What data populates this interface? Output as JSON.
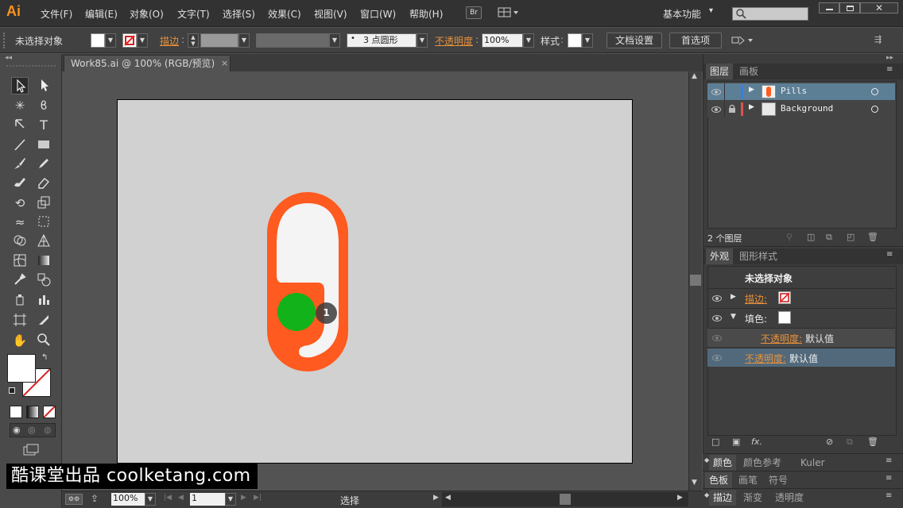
{
  "app": {
    "logo": "Ai"
  },
  "menu": [
    "文件(F)",
    "编辑(E)",
    "对象(O)",
    "文字(T)",
    "选择(S)",
    "效果(C)",
    "视图(V)",
    "窗口(W)",
    "帮助(H)"
  ],
  "menubar_right": {
    "bridge_label": "Br",
    "workspace": "基本功能",
    "search_placeholder": ""
  },
  "controlbar": {
    "selection_status": "未选择对象",
    "stroke_label": "描边",
    "brush_label": "3 点圆形",
    "opacity_label": "不透明度",
    "opacity_value": "100%",
    "style_label": "样式",
    "doc_setup": "文档设置",
    "preferences": "首选项"
  },
  "document": {
    "tab_title": "Work85.ai @ 100% (RGB/预览)",
    "close_glyph": "×"
  },
  "artwork": {
    "pill_color": "#ff5a1f",
    "inner_color": "#f4f4f4",
    "dot_color": "#12b21a",
    "badge_text": "1"
  },
  "layers_panel": {
    "tabs": [
      "图层",
      "画板"
    ],
    "layers": [
      {
        "name": "Pills",
        "color": "#3b7de0",
        "locked": false,
        "selected": true
      },
      {
        "name": "Background",
        "color": "#e05050",
        "locked": true,
        "selected": false
      }
    ],
    "count_label": "2 个图层"
  },
  "appearance_panel": {
    "tabs": [
      "外观",
      "图形样式"
    ],
    "header": "未选择对象",
    "rows": [
      {
        "label": "描边:",
        "kind": "stroke"
      },
      {
        "label": "填色:",
        "kind": "fill"
      },
      {
        "label": "不透明度:",
        "value": "默认值",
        "kind": "sub-opacity"
      },
      {
        "label": "不透明度:",
        "value": "默认值",
        "kind": "opacity"
      }
    ],
    "fx_label": "fx."
  },
  "collapsed_panels": [
    {
      "tabs": [
        "颜色",
        "颜色参考",
        "Kuler"
      ]
    },
    {
      "tabs": [
        "色板",
        "画笔",
        "符号"
      ]
    },
    {
      "tabs": [
        "描边",
        "渐变",
        "透明度"
      ]
    }
  ],
  "statusbar": {
    "zoom": "100%",
    "page": "1",
    "tool_status": "选择"
  },
  "watermark": {
    "text": "酷课堂出品 coolketang.com"
  }
}
